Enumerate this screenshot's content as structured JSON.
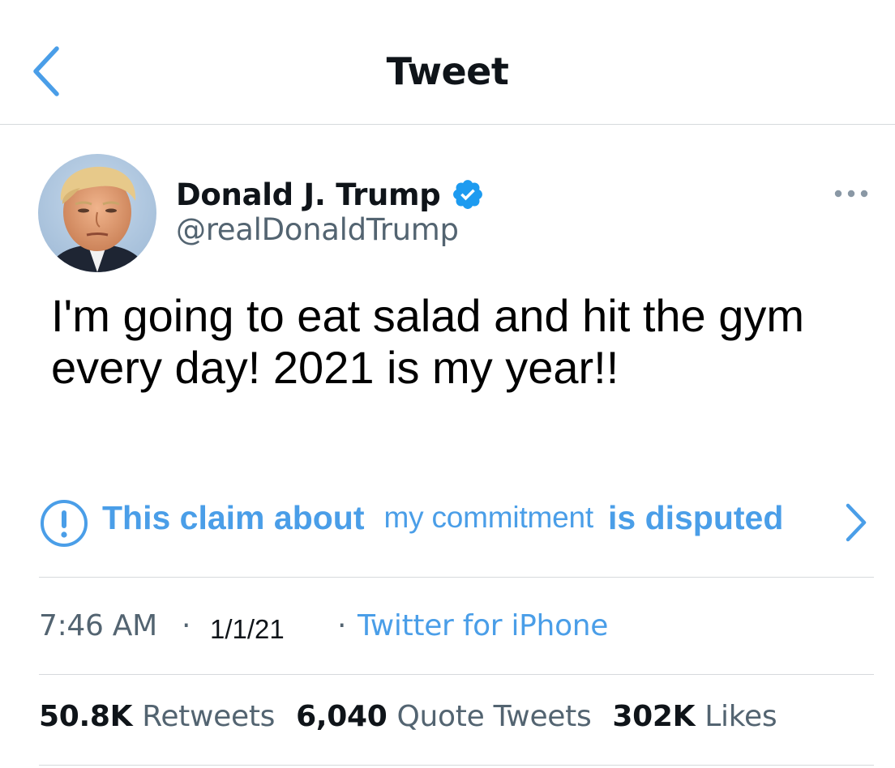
{
  "header": {
    "title": "Tweet",
    "back_icon": "chevron-left-icon"
  },
  "author": {
    "display_name": "Donald J. Trump",
    "handle": "@realDonaldTrump",
    "verified": true,
    "verified_icon": "verified-badge-icon"
  },
  "tweet": {
    "text": "I'm going to eat salad and hit the gym every day! 2021 is my year!!"
  },
  "notice": {
    "icon": "exclamation-circle-icon",
    "part1": "This claim about",
    "part2": "my commitment",
    "part3": "is disputed",
    "chevron_icon": "chevron-right-icon"
  },
  "meta": {
    "time": "7:46 AM",
    "separator": "·",
    "date": "1/1/21",
    "source": "Twitter for iPhone"
  },
  "stats": {
    "retweets_count": "50.8K",
    "retweets_label": "Retweets",
    "quotes_count": "6,040",
    "quotes_label": "Quote Tweets",
    "likes_count": "302K",
    "likes_label": "Likes"
  },
  "colors": {
    "link": "#4a9ee8",
    "verified": "#1d9bf0",
    "secondary_text": "#536471",
    "divider": "#d6d9dc"
  }
}
